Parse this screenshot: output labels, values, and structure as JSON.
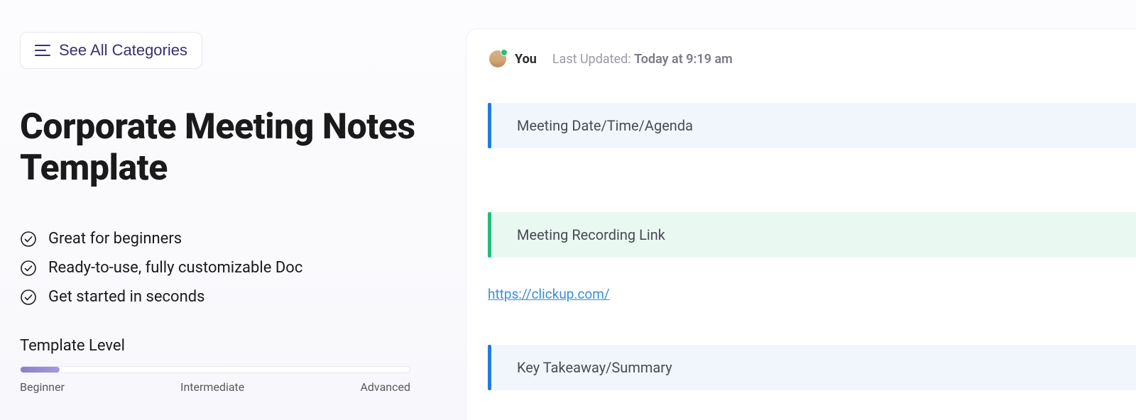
{
  "left": {
    "see_all_label": "See All Categories",
    "title": "Corporate Meeting Notes Template",
    "features": [
      "Great for beginners",
      "Ready-to-use, fully customizable Doc",
      "Get started in seconds"
    ],
    "template_level_label": "Template Level",
    "level_ticks": {
      "beginner": "Beginner",
      "intermediate": "Intermediate",
      "advanced": "Advanced"
    }
  },
  "doc": {
    "author": "You",
    "updated_label": "Last Updated: ",
    "updated_value": "Today at 9:19 am",
    "sections": {
      "agenda": "Meeting Date/Time/Agenda",
      "recording": "Meeting Recording Link",
      "link": "https://clickup.com/",
      "summary": "Key Takeaway/Summary"
    }
  }
}
